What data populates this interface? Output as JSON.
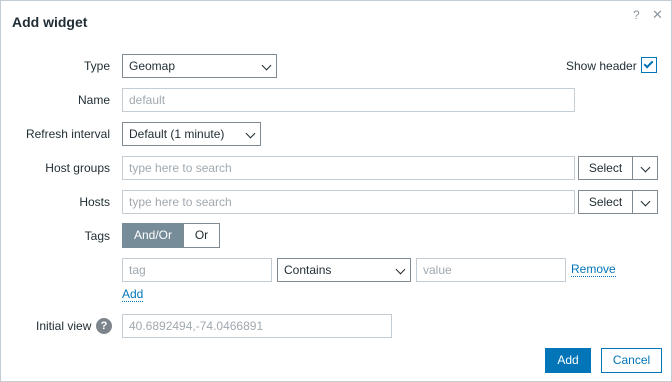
{
  "dialog": {
    "title": "Add widget",
    "help_glyph": "?",
    "close_glyph": "✕"
  },
  "form": {
    "type": {
      "label": "Type",
      "value": "Geomap"
    },
    "show_header": {
      "label": "Show header",
      "checked": true
    },
    "name": {
      "label": "Name",
      "placeholder": "default",
      "value": ""
    },
    "refresh": {
      "label": "Refresh interval",
      "value": "Default (1 minute)"
    },
    "host_groups": {
      "label": "Host groups",
      "placeholder": "type here to search",
      "select_label": "Select"
    },
    "hosts": {
      "label": "Hosts",
      "placeholder": "type here to search",
      "select_label": "Select"
    },
    "tags": {
      "label": "Tags",
      "modes": [
        "And/Or",
        "Or"
      ],
      "active_mode": "And/Or",
      "row": {
        "tag_placeholder": "tag",
        "operator": "Contains",
        "value_placeholder": "value",
        "remove_label": "Remove"
      },
      "add_label": "Add"
    },
    "initial_view": {
      "label": "Initial view",
      "help_glyph": "?",
      "placeholder": "40.6892494,-74.0466891"
    }
  },
  "footer": {
    "add_label": "Add",
    "cancel_label": "Cancel"
  },
  "colors": {
    "accent": "#0275b8",
    "border": "#c5cdd4",
    "text": "#1f2c33",
    "placeholder": "#a0a9b0",
    "segment_active": "#768d99"
  }
}
